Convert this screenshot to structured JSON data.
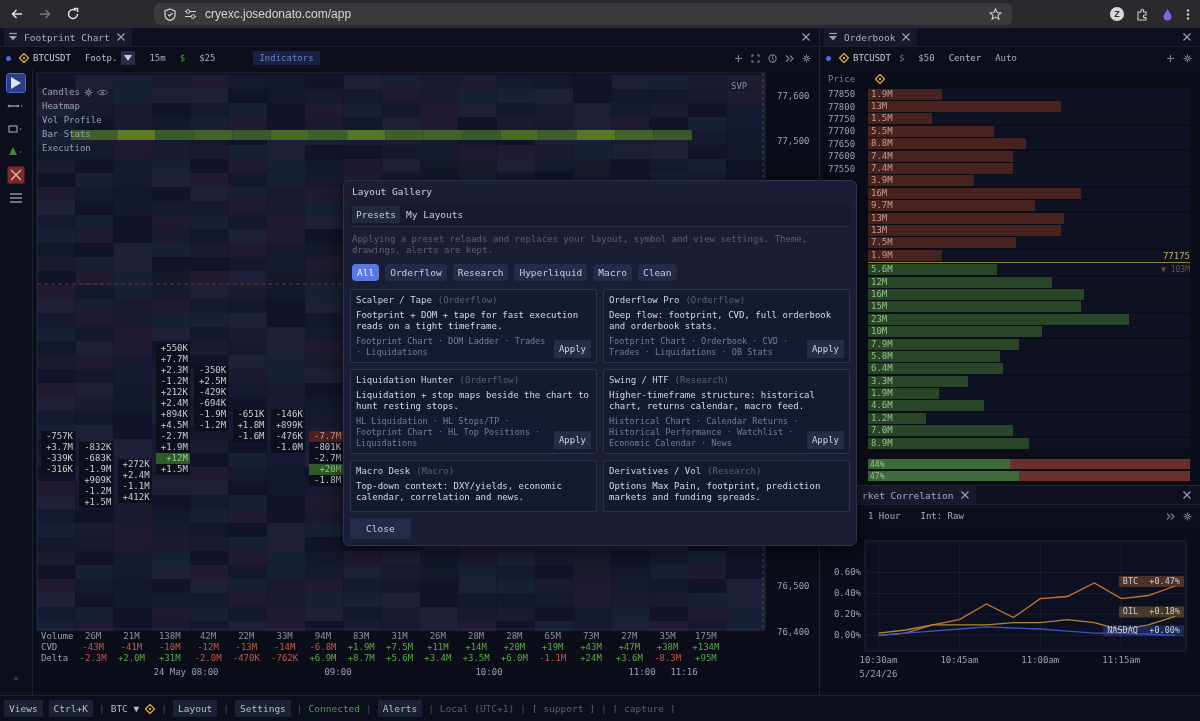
{
  "browser": {
    "url": "cryexc.josedonato.com/app",
    "profile_initial": "Z"
  },
  "footprint": {
    "tab": {
      "title": "Footprint Chart"
    },
    "toolbar": {
      "symbol": "BTCUSDT",
      "chart_type": "Footp.",
      "interval": "15m",
      "currency": "$",
      "tick_size": "$25",
      "indicators": "Indicators"
    },
    "tools": [
      {
        "kind": "cursor",
        "selected": true
      },
      {
        "kind": "line",
        "selected": false
      },
      {
        "kind": "rect",
        "selected": false
      },
      {
        "kind": "triangle",
        "selected": false
      },
      {
        "kind": "delete",
        "selected": false
      },
      {
        "kind": "menu",
        "selected": false
      }
    ],
    "layers": [
      {
        "label": "Candles",
        "controls": true
      },
      {
        "label": "Heatmap",
        "controls": false
      },
      {
        "label": "Vol Profile",
        "controls": false
      },
      {
        "label": "Bar Stats",
        "controls": false
      },
      {
        "label": "Execution",
        "controls": false
      }
    ],
    "svp_label": "SVP",
    "clusters": [
      {
        "cells": [
          {
            "value": "-757K",
            "highlight": false
          },
          {
            "value": "+3.7M",
            "highlight": false
          },
          {
            "value": "-339K",
            "highlight": false
          },
          {
            "value": "-316K",
            "highlight": false
          }
        ]
      },
      {
        "cells": [
          {
            "value": "-832K",
            "highlight": false
          },
          {
            "value": "-683K",
            "highlight": false
          },
          {
            "value": "-1.9M",
            "highlight": false
          },
          {
            "value": "+909K",
            "highlight": false
          },
          {
            "value": "-1.2M",
            "highlight": false
          },
          {
            "value": "+1.5M",
            "highlight": false
          }
        ]
      },
      {
        "cells": [
          {
            "value": "+272K",
            "highlight": false
          },
          {
            "value": "+2.4M",
            "highlight": false
          },
          {
            "value": "-1.1M",
            "highlight": false
          },
          {
            "value": "+412K",
            "highlight": false
          }
        ]
      },
      {
        "cells": [
          {
            "value": "+550K",
            "highlight": false
          },
          {
            "value": "+7.7M",
            "highlight": false
          },
          {
            "value": "+2.3M",
            "highlight": false
          },
          {
            "value": "-1.2M",
            "highlight": false
          },
          {
            "value": "+212K",
            "highlight": false
          },
          {
            "value": "+2.4M",
            "highlight": false
          },
          {
            "value": "+894K",
            "highlight": false
          },
          {
            "value": "+4.5M",
            "highlight": false
          },
          {
            "value": "-2.7M",
            "highlight": false
          },
          {
            "value": "+1.9M",
            "highlight": false
          },
          {
            "value": "+12M",
            "highlight": true
          },
          {
            "value": "+1.5M",
            "highlight": false
          }
        ]
      },
      {
        "cells": [
          {
            "value": "-350K",
            "highlight": false
          },
          {
            "value": "+2.5M",
            "highlight": false
          },
          {
            "value": "-429K",
            "highlight": false
          },
          {
            "value": "-694K",
            "highlight": false
          },
          {
            "value": "-1.9M",
            "highlight": false
          },
          {
            "value": "-1.2M",
            "highlight": false
          }
        ]
      },
      {
        "cells": [
          {
            "value": "-651K",
            "highlight": false
          },
          {
            "value": "+1.8M",
            "highlight": false
          },
          {
            "value": "-1.6M",
            "highlight": false
          }
        ]
      },
      {
        "cells": [
          {
            "value": "-146K",
            "highlight": false
          },
          {
            "value": "+899K",
            "highlight": false
          },
          {
            "value": "-476K",
            "highlight": false
          },
          {
            "value": "-1.0M",
            "highlight": false
          }
        ]
      },
      {
        "cells": [
          {
            "value": "-7.7M",
            "highlight": true
          },
          {
            "value": "-801K",
            "highlight": false
          },
          {
            "value": "-2.7M",
            "highlight": false
          },
          {
            "value": "+20M",
            "highlight": true
          },
          {
            "value": "-1.8M",
            "highlight": false
          }
        ]
      }
    ],
    "price_labels": [
      "77,600",
      "77,500",
      "76,500",
      "76,400"
    ],
    "stats": [
      {
        "label": "Volume",
        "values": [
          "26M",
          "21M",
          "138M",
          "42M",
          "22M",
          "33M",
          "94M",
          "83M",
          "31M",
          "26M",
          "28M",
          "28M",
          "65M",
          "73M",
          "27M",
          "35M",
          "175M"
        ]
      },
      {
        "label": "CVD",
        "values": [
          "-43M",
          "-41M",
          "-10M",
          "-12M",
          "-13M",
          "-14M",
          "-6.8M",
          "+1.9M",
          "+7.5M",
          "+11M",
          "+14M",
          "+20M",
          "+19M",
          "+43M",
          "+47M",
          "+38M",
          "+134M"
        ]
      },
      {
        "label": "Delta",
        "values": [
          "-2.3M",
          "+2.0M",
          "+31M",
          "-2.0M",
          "-470K",
          "-762K",
          "+6.9M",
          "+8.7M",
          "+5.6M",
          "+3.4M",
          "+3.5M",
          "+6.0M",
          "-1.1M",
          "+24M",
          "+3.6M",
          "-8.3M",
          "+95M"
        ]
      }
    ],
    "time_labels": [
      "24 May 08:00",
      "09:00",
      "10:00",
      "11:00",
      "11:16"
    ],
    "collapse_glyph": "«"
  },
  "orderbook": {
    "tab": {
      "title": "Orderbook"
    },
    "toolbar": {
      "symbol": "BTCUSDT",
      "currency": "$",
      "tick_size": "$50",
      "center": "Center",
      "auto": "Auto"
    },
    "price_header": "Price",
    "asks": [
      {
        "price": "77850",
        "size": "1.9M",
        "level": 0.23
      },
      {
        "price": "77800",
        "size": "13M",
        "level": 0.6
      },
      {
        "price": "77750",
        "size": "1.5M",
        "level": 0.2
      },
      {
        "price": "77700",
        "size": "5.5M",
        "level": 0.39
      },
      {
        "price": "77650",
        "size": "8.8M",
        "level": 0.49
      },
      {
        "price": "77600",
        "size": "7.4M",
        "level": 0.45
      },
      {
        "price": "77550",
        "size": "7.4M",
        "level": 0.45
      },
      {
        "size": "3.9M",
        "level": 0.33
      },
      {
        "size": "16M",
        "level": 0.66
      },
      {
        "size": "9.7M",
        "level": 0.52
      },
      {
        "size": "13M",
        "level": 0.61
      },
      {
        "size": "13M",
        "level": 0.6
      },
      {
        "size": "7.5M",
        "level": 0.46
      },
      {
        "size": "1.9M",
        "level": 0.23
      }
    ],
    "mid_price": "77175",
    "mid_volume": "▼ 103M",
    "bids": [
      {
        "size": "5.6M",
        "level": 0.4
      },
      {
        "size": "12M",
        "level": 0.57
      },
      {
        "size": "16M",
        "level": 0.67
      },
      {
        "size": "15M",
        "level": 0.66
      },
      {
        "size": "23M",
        "level": 0.81
      },
      {
        "size": "10M",
        "level": 0.54
      },
      {
        "size": "7.9M",
        "level": 0.47
      },
      {
        "size": "5.8M",
        "level": 0.41
      },
      {
        "size": "6.4M",
        "level": 0.42
      },
      {
        "size": "3.3M",
        "level": 0.31
      },
      {
        "size": "1.9M",
        "level": 0.22
      },
      {
        "size": "4.6M",
        "level": 0.36
      },
      {
        "size": "1.2M",
        "level": 0.18
      },
      {
        "size": "7.0M",
        "level": 0.45
      },
      {
        "size": "8.9M",
        "level": 0.5
      }
    ],
    "ratios": [
      {
        "label": "44%",
        "level": 0.44
      },
      {
        "label": "47%",
        "level": 0.47
      }
    ]
  },
  "correlation": {
    "tab": {
      "title": "rket Correlation"
    },
    "toolbar": {
      "range": "1 Hour",
      "interval": "Int: Raw"
    },
    "chart_data": {
      "type": "line",
      "categories": [
        "10:30am",
        null,
        null,
        "10:45am",
        null,
        null,
        "11:00am",
        null,
        null,
        "11:15am",
        null,
        null
      ],
      "ylim": [
        -0.15,
        0.9
      ],
      "grid": true,
      "yticks": [
        {
          "value": 0,
          "label": "0.00%"
        },
        {
          "value": 0.2,
          "label": "0.20%"
        },
        {
          "value": 0.4,
          "label": "0.40%"
        },
        {
          "value": 0.6,
          "label": "0.60%"
        }
      ],
      "series": [
        {
          "name": "BTC",
          "color": "#c8743a",
          "values": [
            0,
            0.02,
            0.1,
            0.15,
            0.3,
            0.17,
            0.35,
            0.37,
            0.5,
            0.35,
            0.38,
            0.47
          ]
        },
        {
          "name": "OIL",
          "color": "#b0863c",
          "values": [
            0.02,
            0.05,
            0.1,
            0.1,
            0.1,
            0.12,
            0.12,
            0.15,
            0.12,
            0.05,
            0.1,
            0.18
          ]
        },
        {
          "name": "NASDAQ",
          "color": "#3b55c4",
          "values": [
            0,
            0.02,
            0.04,
            0.06,
            0.08,
            0.07,
            0.06,
            0.04,
            0.02,
            0.02,
            0.01,
            0
          ]
        }
      ],
      "annotations": [
        "+0.47%",
        "+0.18%",
        "+0.00%"
      ]
    },
    "date_label": "5/24/26"
  },
  "status_bar": [
    {
      "kind": "button",
      "label": "Views"
    },
    {
      "kind": "button",
      "label": "Ctrl+K"
    },
    {
      "kind": "sep",
      "label": "|"
    },
    {
      "kind": "select",
      "label": "BTC ▼"
    },
    {
      "kind": "exchange"
    },
    {
      "kind": "sep",
      "label": "|"
    },
    {
      "kind": "button",
      "label": "Layout"
    },
    {
      "kind": "sep",
      "label": "|"
    },
    {
      "kind": "button",
      "label": "Settings"
    },
    {
      "kind": "sep",
      "label": "|"
    },
    {
      "kind": "status",
      "label": "Connected"
    },
    {
      "kind": "sep",
      "label": "|"
    },
    {
      "kind": "button",
      "label": "Alerts"
    },
    {
      "kind": "sep",
      "label": "|"
    },
    {
      "kind": "dim",
      "label": "Local (UTC+1)"
    },
    {
      "kind": "sep",
      "label": "|"
    },
    {
      "kind": "link",
      "label": "[ support ]"
    },
    {
      "kind": "sep",
      "label": "|"
    },
    {
      "kind": "link",
      "label": "[ capture ]"
    }
  ],
  "modal": {
    "title": "Layout Gallery",
    "tabs": [
      {
        "label": "Presets",
        "selected": true
      },
      {
        "label": "My Layouts",
        "selected": false
      }
    ],
    "note": "Applying a preset reloads and replaces your layout, symbol and view settings. Theme, drawings, alerts are kept.",
    "filters": [
      {
        "label": "All",
        "selected": true
      },
      {
        "label": "Orderflow",
        "selected": false
      },
      {
        "label": "Research",
        "selected": false
      },
      {
        "label": "Hyperliquid",
        "selected": false
      },
      {
        "label": "Macro",
        "selected": false
      },
      {
        "label": "Clean",
        "selected": false
      }
    ],
    "presets": [
      {
        "title": "Scalper / Tape",
        "category": "(Orderflow)",
        "description": "Footprint + DOM + tape for fast execution reads on a tight timeframe.",
        "panels": "Footprint Chart  ·  DOM Ladder  ·  Trades  ·  Liquidations",
        "apply": "Apply"
      },
      {
        "title": "Orderflow Pro",
        "category": "(Orderflow)",
        "description": "Deep flow: footprint, CVD, full orderbook and orderbook stats.",
        "panels": "Footprint Chart  ·  Orderbook  ·  CVD  ·  Trades  ·  Liquidations  ·  OB Stats",
        "apply": "Apply"
      },
      {
        "title": "Liquidation Hunter",
        "category": "(Orderflow)",
        "description": "Liquidation + stop maps beside the chart to hunt resting stops.",
        "panels": "HL Liquidation  ·  HL Stops/TP  ·  Footprint Chart  ·  HL Top Positions  ·  Liquidations",
        "apply": "Apply"
      },
      {
        "title": "Swing / HTF",
        "category": "(Research)",
        "description": "Higher-timeframe structure: historical chart, returns calendar, macro feed.",
        "panels": "Historical Chart  ·  Calendar Returns  ·  Historical Performance  ·  Watchlist  ·  Economic Calendar  ·  News",
        "apply": "Apply"
      },
      {
        "title": "Macro Desk",
        "category": "(Macro)",
        "description": "Top-down context: DXY/yields, economic calendar, correlation and news."
      },
      {
        "title": "Derivatives / Vol",
        "category": "(Research)",
        "description": "Options Max Pain, footprint, prediction markets and funding spreads."
      }
    ],
    "close": "Close"
  }
}
